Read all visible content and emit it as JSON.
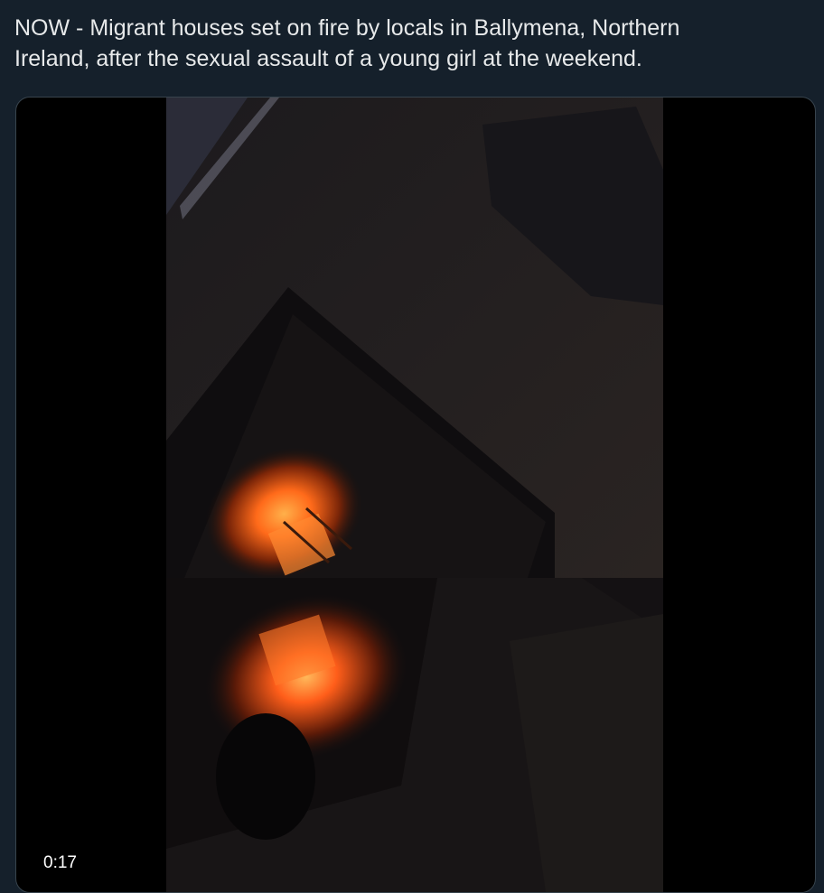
{
  "tweet": {
    "text": "NOW - Migrant houses set on fire by locals in Ballymena, Northern\nIreland, after the sexual assault of a young girl at the weekend."
  },
  "video": {
    "duration": "0:17"
  },
  "colors": {
    "background": "#15202b",
    "text": "#e7e9ea",
    "media_border": "#38444d",
    "fire": "#ff6a1a"
  }
}
